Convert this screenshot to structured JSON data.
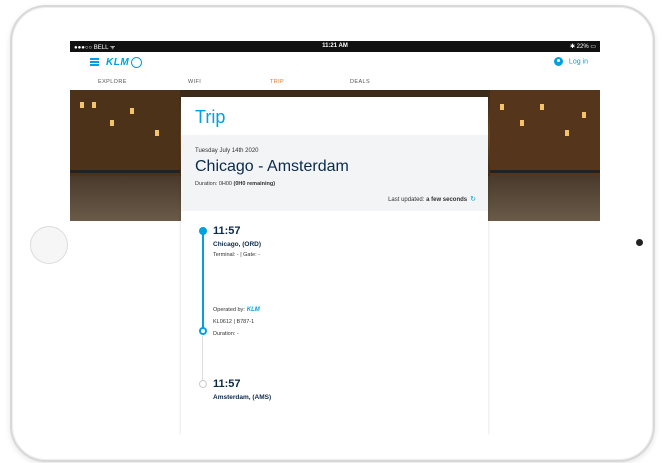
{
  "statusbar": {
    "carrier": "●●●○○ BELL ᯤ",
    "time": "11:21 AM",
    "battery": "✱ 22% ▭"
  },
  "header": {
    "logo": "KLM",
    "login_label": "Log in"
  },
  "nav": {
    "tabs": [
      {
        "label": "EXPLORE"
      },
      {
        "label": "WIFI"
      },
      {
        "label": "TRIP"
      },
      {
        "label": "DEALS"
      }
    ],
    "active_tab": "TRIP"
  },
  "trip": {
    "title": "Trip",
    "date": "Tuesday July 14th 2020",
    "route": "Chicago - Amsterdam",
    "duration_label": "Duration: 0H00",
    "duration_remaining": "(0H0 remaining)",
    "last_updated_label": "Last updated:",
    "last_updated_value": "a few seconds",
    "refresh_icon": "↻",
    "departure": {
      "time": "11:57",
      "city": "Chicago, (ORD)",
      "terminal": "Terminal: - | Gate: -"
    },
    "operated_by_label": "Operated by:",
    "operated_by_logo": "KLM",
    "flight_info": "KL0612 | B787-1",
    "flight_duration": "Duration: -",
    "arrival": {
      "time": "11:57",
      "city": "Amsterdam, (AMS)"
    }
  },
  "colors": {
    "accent": "#00a1de",
    "active_tab": "#e37222",
    "heading_dark": "#0b2a4a"
  }
}
